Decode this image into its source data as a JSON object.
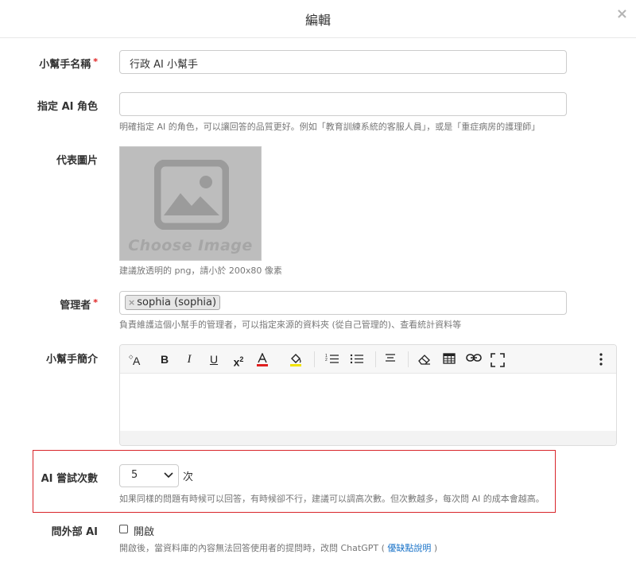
{
  "modal": {
    "title": "編輯",
    "close": "×"
  },
  "form": {
    "name": {
      "label": "小幫手名稱",
      "required": "*",
      "value": "行政 AI 小幫手"
    },
    "role": {
      "label": "指定 AI 角色",
      "value": "",
      "help": "明確指定 AI 的角色，可以讓回答的品質更好。例如「教育訓練系統的客服人員」，或是「重症病房的護理師」"
    },
    "image": {
      "label": "代表圖片",
      "placeholder": "Choose Image",
      "help": "建議放透明的 png，請小於 200x80 像素"
    },
    "managers": {
      "label": "管理者",
      "required": "*",
      "tags": [
        "sophia (sophia)"
      ],
      "tag_remove": "×",
      "help": "負責維護這個小幫手的管理者，可以指定來源的資料夾 (從自己管理的)、查看統計資料等"
    },
    "intro": {
      "label": "小幫手簡介"
    },
    "attempts": {
      "label": "AI 嘗試次數",
      "value": "5",
      "unit": "次",
      "help": "如果同樣的問題有時候可以回答，有時候卻不行，建議可以調高次數。但次數越多，每次問 AI 的成本會越高。"
    },
    "external": {
      "label": "問外部 AI",
      "checkbox_label": "開啟",
      "checked": false,
      "help_before": "開啟後，當資料庫的內容無法回答使用者的提問時，改問 ChatGPT ( ",
      "help_link": "優缺點說明",
      "help_after": " )"
    }
  },
  "toolbar": [
    "font-size-icon",
    "bold-icon",
    "italic-icon",
    "underline-icon",
    "superscript-icon",
    "text-color-icon",
    "highlight-color-icon",
    "ordered-list-icon",
    "unordered-list-icon",
    "align-icon",
    "eraser-icon",
    "table-icon",
    "link-icon",
    "fullscreen-icon",
    "more-icon"
  ],
  "colors": {
    "highlight_border": "#d9262b",
    "required": "#e02020",
    "link": "#1a73c8",
    "text_color_bar": "#e02020",
    "fill_color_bar": "#f2e300"
  }
}
